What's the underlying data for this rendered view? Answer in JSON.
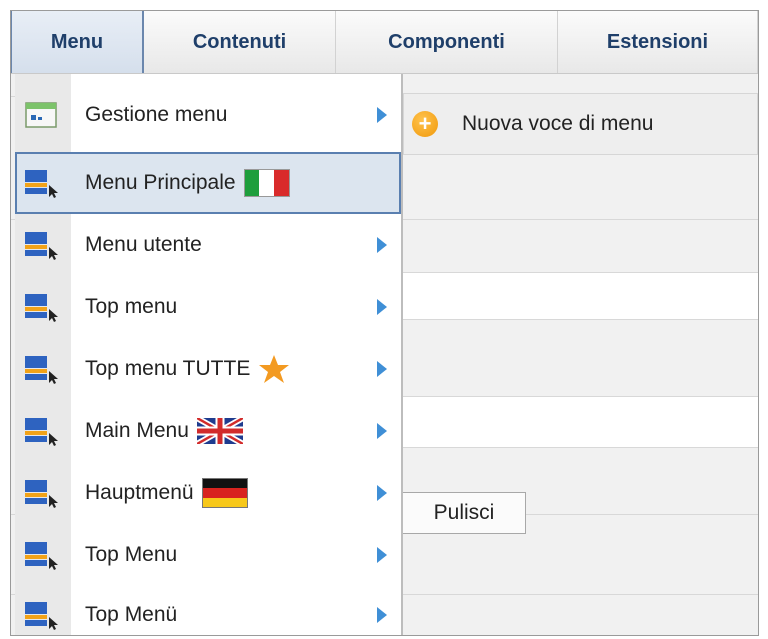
{
  "menubar": {
    "items": [
      {
        "label": "Menu",
        "active": true
      },
      {
        "label": "Contenuti",
        "active": false
      },
      {
        "label": "Componenti",
        "active": false
      },
      {
        "label": "Estensioni",
        "active": false
      }
    ]
  },
  "dropdown": {
    "items": [
      {
        "label": "Gestione menu",
        "icon": "menu-manager-icon",
        "has_submenu": true
      },
      {
        "label": "Menu Principale",
        "icon": "menu-icon",
        "flag": "italy-flag-icon",
        "selected": true,
        "has_submenu": false
      },
      {
        "label": "Menu utente",
        "icon": "menu-icon",
        "has_submenu": true
      },
      {
        "label": "Top menu",
        "icon": "menu-icon",
        "has_submenu": true
      },
      {
        "label": "Top menu TUTTE",
        "icon": "menu-icon",
        "badge": "star-icon",
        "has_submenu": true
      },
      {
        "label": "Main Menu",
        "icon": "menu-icon",
        "flag": "uk-flag-icon",
        "has_submenu": true
      },
      {
        "label": "Hauptmenü",
        "icon": "menu-icon",
        "flag": "germany-flag-icon",
        "has_submenu": true
      },
      {
        "label": "Top Menu",
        "icon": "menu-icon",
        "has_submenu": true
      },
      {
        "label": "Top Menü",
        "icon": "menu-icon",
        "has_submenu": true
      }
    ]
  },
  "submenu": {
    "new_item_label": "Nuova voce di menu",
    "new_item_icon": "add-icon"
  },
  "page": {
    "clear_button_label": "Pulisci"
  },
  "colors": {
    "menubar_text": "#1f3f6a",
    "selected_bg": "#dce5ef",
    "selected_border": "#5a7fb0",
    "arrow": "#3f8fd6",
    "add_icon": "#f0980a"
  }
}
